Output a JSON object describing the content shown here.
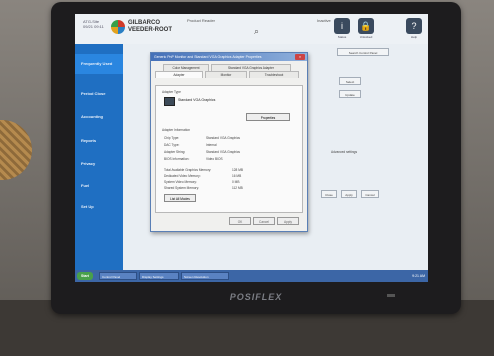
{
  "header": {
    "user_line1": "ATG-Site",
    "user_line2": "09/21 09:11",
    "brand_line1": "GILBARCO",
    "brand_line2": "VEEDER-ROOT",
    "product_label": "Product Reader",
    "status_label": "Inactive",
    "buttons": [
      {
        "icon": "i",
        "label": "Status"
      },
      {
        "icon": "🔒",
        "label": "Unlocked"
      },
      {
        "icon": "?",
        "label": "Help"
      }
    ]
  },
  "sidebar": {
    "items": [
      {
        "label": "Frequently Used"
      },
      {
        "label": "Period Close"
      },
      {
        "label": "Accounting"
      },
      {
        "label": "Reports"
      },
      {
        "label": "Privacy"
      },
      {
        "label": "Fuel"
      },
      {
        "label": "Set Up"
      }
    ]
  },
  "content": {
    "search_field": "Search Control Panel",
    "btn_a": "Select",
    "btn_b": "Update",
    "side_label": "Advanced settings",
    "bottom_buttons": [
      "Close",
      "Apply",
      "Cancel"
    ]
  },
  "dialog": {
    "title": "Generic PnP Monitor and Standard VGA Graphics Adapter Properties",
    "tabs_row1": [
      "Color Management",
      "Standard VGA Graphics Adapter"
    ],
    "tabs_row2": [
      "Adapter",
      "Monitor",
      "Troubleshoot"
    ],
    "adapter_type_label": "Adapter Type",
    "adapter_name": "Standard VGA Graphics",
    "properties_button": "Properties",
    "info_heading": "Adapter Information",
    "info": [
      {
        "k": "Chip Type:",
        "v": "Standard VGA Graphics"
      },
      {
        "k": "DAC Type:",
        "v": "Internal"
      },
      {
        "k": "Adapter String:",
        "v": "Standard VGA Graphics"
      },
      {
        "k": "BIOS Information:",
        "v": "Video BIOS"
      }
    ],
    "memory": [
      {
        "k": "Total Available Graphics Memory:",
        "v": "128 MB"
      },
      {
        "k": "Dedicated Video Memory:",
        "v": "16 MB"
      },
      {
        "k": "System Video Memory:",
        "v": "0 MB"
      },
      {
        "k": "Shared System Memory:",
        "v": "112 MB"
      }
    ],
    "list_modes_button": "List All Modes",
    "footer_buttons": [
      "OK",
      "Cancel",
      "Apply"
    ]
  },
  "taskbar": {
    "start_label": "Start",
    "tasks": [
      "Control Panel",
      "Display Settings",
      "Screen Resolution"
    ],
    "clock": "9:21 AM"
  },
  "device_brand": "POSIFLEX"
}
